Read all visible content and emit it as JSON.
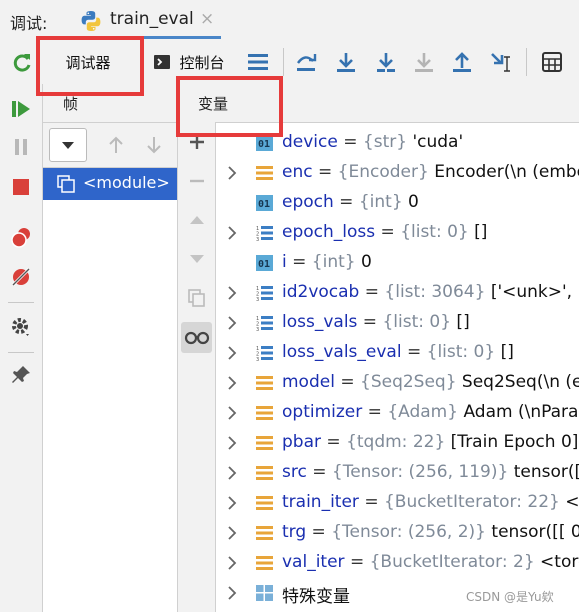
{
  "header": {
    "debug_label": "调试:",
    "tab_name": "train_eval",
    "tab_close": "×"
  },
  "toolbar": {
    "debugger_tab": "调试器",
    "console_tab": "控制台"
  },
  "frames": {
    "title": "帧",
    "module": "<module>"
  },
  "variables": {
    "title": "变量",
    "items": [
      {
        "icon": "int",
        "expand": false,
        "name": "device",
        "eq": " = ",
        "type": "{str}",
        "value": " 'cuda'"
      },
      {
        "icon": "obj",
        "expand": true,
        "name": "enc",
        "eq": " = ",
        "type": "{Encoder}",
        "value": " Encoder(\\n  (embe"
      },
      {
        "icon": "int",
        "expand": false,
        "name": "epoch",
        "eq": " = ",
        "type": "{int}",
        "value": " 0"
      },
      {
        "icon": "list",
        "expand": true,
        "name": "epoch_loss",
        "eq": " = ",
        "type": "{list: 0}",
        "value": " []"
      },
      {
        "icon": "int",
        "expand": false,
        "name": "i",
        "eq": " = ",
        "type": "{int}",
        "value": " 0"
      },
      {
        "icon": "list",
        "expand": true,
        "name": "id2vocab",
        "eq": " = ",
        "type": "{list: 3064}",
        "value": " ['<unk>', '<"
      },
      {
        "icon": "list",
        "expand": true,
        "name": "loss_vals",
        "eq": " = ",
        "type": "{list: 0}",
        "value": " []"
      },
      {
        "icon": "list",
        "expand": true,
        "name": "loss_vals_eval",
        "eq": " = ",
        "type": "{list: 0}",
        "value": " []"
      },
      {
        "icon": "obj",
        "expand": true,
        "name": "model",
        "eq": " = ",
        "type": "{Seq2Seq}",
        "value": " Seq2Seq(\\n  (en"
      },
      {
        "icon": "obj",
        "expand": true,
        "name": "optimizer",
        "eq": " = ",
        "type": "{Adam}",
        "value": " Adam (\\nParam"
      },
      {
        "icon": "obj",
        "expand": true,
        "name": "pbar",
        "eq": " = ",
        "type": "{tqdm: 22}",
        "value": " [Train Epoch 0]:"
      },
      {
        "icon": "obj",
        "expand": true,
        "name": "src",
        "eq": " = ",
        "type": "{Tensor: (256, 119)}",
        "value": " tensor([["
      },
      {
        "icon": "obj",
        "expand": true,
        "name": "train_iter",
        "eq": " = ",
        "type": "{BucketIterator: 22}",
        "value": " <to"
      },
      {
        "icon": "obj",
        "expand": true,
        "name": "trg",
        "eq": " = ",
        "type": "{Tensor: (256, 2)}",
        "value": " tensor([[  0,"
      },
      {
        "icon": "obj",
        "expand": true,
        "name": "val_iter",
        "eq": " = ",
        "type": "{BucketIterator: 2}",
        "value": " <torch"
      },
      {
        "icon": "special",
        "expand": true,
        "name": "特殊变量",
        "eq": "",
        "type": "",
        "value": ""
      }
    ]
  },
  "watermark": "CSDN @是Yu欸",
  "colors": {
    "accent": "#4a86c8",
    "selection": "#2f65ca",
    "highlight": "#e63b3b"
  }
}
